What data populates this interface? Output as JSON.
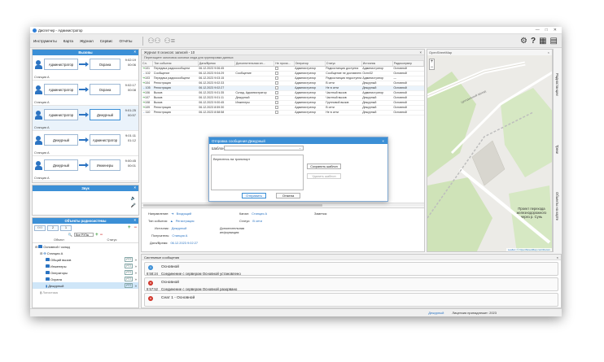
{
  "app": {
    "title": "Диспетчер - Администратор",
    "window_controls": [
      "—",
      "□",
      "✕"
    ]
  },
  "menu": {
    "items": [
      "Инструменты",
      "Карта",
      "Журнал",
      "Сервис",
      "Отчёты"
    ]
  },
  "calls": {
    "title": "Вызовы",
    "items": [
      {
        "from": "Администратор",
        "to": "Охрана",
        "time": "9:02:19",
        "dur": "00:06",
        "station": "Станция А"
      },
      {
        "from": "Администратор",
        "to": "Охрана",
        "time": "9:02:17",
        "dur": "00:08",
        "station": "Станция А"
      },
      {
        "from": "Администратор",
        "to": "Дежурный",
        "time": "9:01:25",
        "dur": "00:57",
        "station": "Станция А"
      },
      {
        "from": "Дежурный",
        "to": "Администратор",
        "time": "9:01:11",
        "dur": "01:12",
        "station": "Станция А"
      },
      {
        "from": "Дежурный",
        "to": "Инженеры",
        "time": "9:00:45",
        "dur": "00:01",
        "station": "Станция А"
      }
    ]
  },
  "sound": {
    "title": "Звук"
  },
  "objects": {
    "title": "Объекты радиосистемы",
    "tb1": "2",
    "tb2": "1",
    "tb3": "1",
    "filter": "Все РУПы",
    "col_obj": "Объект",
    "col_status": "Статус",
    "tree": [
      {
        "label": "Основной / склад",
        "indent": 0,
        "tag": ""
      },
      {
        "label": "Станция А",
        "indent": 1,
        "tag": ""
      },
      {
        "label": "Общий вызов",
        "indent": 2,
        "tag": "РТТ"
      },
      {
        "label": "Инженеры",
        "indent": 2,
        "tag": "РТТ"
      },
      {
        "label": "Операторы",
        "indent": 2,
        "tag": "РТТ"
      },
      {
        "label": "Охрана",
        "indent": 2,
        "tag": "РТТ"
      },
      {
        "label": "Дежурный",
        "indent": 2,
        "tag": "РТТ"
      },
      {
        "label": "Логистика",
        "indent": 1,
        "tag": ""
      }
    ]
  },
  "journal": {
    "title": "Журнал 8 сеансов: записей - 10",
    "group_hint": "Перетащите заголовок колонки сюда для группировки данных",
    "columns": [
      "Сл.",
      "Тип события",
      "Дата/Время",
      "Дополнительная ин...",
      "Не прочи...",
      "Оператор",
      "Статус",
      "Источник",
      "Радиосервер"
    ],
    "rows": [
      {
        "id": "101",
        "type": "Передача радиосообщени",
        "dt": "06.12.2023 9:06:45",
        "info": "",
        "op": "Администратор",
        "status": "Радиостанция доступна",
        "src": "Администратор",
        "srv": "Основной",
        "dir": "in"
      },
      {
        "id": "102",
        "type": "Сообщение",
        "dt": "06.12.2023 9:04:29",
        "info": "Сообщение",
        "op": "Администратор",
        "status": "Сообщение не доставлено",
        "src": "Ocmr32",
        "srv": "Основной",
        "dir": "out"
      },
      {
        "id": "103",
        "type": "Передача радиосообщени",
        "dt": "06.12.2023 9:03:15",
        "info": "",
        "op": "Администратор",
        "status": "Радиостанция недоступна",
        "src": "Администратор",
        "srv": "—",
        "dir": "in"
      },
      {
        "id": "104",
        "type": "Регистрация",
        "dt": "06.12.2023 9:02:33",
        "info": "",
        "op": "Администратор",
        "status": "В сети",
        "src": "Дежурный",
        "srv": "Основной",
        "dir": "in"
      },
      {
        "id": "105",
        "type": "Регистрация",
        "dt": "06.12.2023 9:02:27",
        "info": "",
        "op": "Администратор",
        "status": "Не в сети",
        "src": "Дежурный",
        "srv": "Основной",
        "dir": "out"
      },
      {
        "id": "106",
        "type": "Вызов",
        "dt": "06.12.2023 9:01:35",
        "info": "Склад, Администратор",
        "op": "Администратор",
        "status": "Частный вызов",
        "src": "Администратор",
        "srv": "Основной",
        "dir": "in"
      },
      {
        "id": "107",
        "type": "Вызов",
        "dt": "06.12.2023 9:01:11",
        "info": "Дежурный",
        "op": "Администратор",
        "status": "Частный вызов",
        "src": "Дежурный",
        "srv": "Основной",
        "dir": "in"
      },
      {
        "id": "108",
        "type": "Вызов",
        "dt": "06.12.2023 9:00:45",
        "info": "Инженеры",
        "op": "Администратор",
        "status": "Групповой вызов",
        "src": "Дежурный",
        "srv": "Основной",
        "dir": "in"
      },
      {
        "id": "109",
        "type": "Регистрация",
        "dt": "06.12.2023 8:59:30",
        "info": "",
        "op": "Администратор",
        "status": "В сети",
        "src": "Дежурный",
        "srv": "Основной",
        "dir": "in"
      },
      {
        "id": "110",
        "type": "Регистрация",
        "dt": "06.12.2023 8:58:58",
        "info": "",
        "op": "Администратор",
        "status": "Не в сети",
        "src": "Дежурный",
        "srv": "Основной",
        "dir": "out"
      }
    ]
  },
  "details": {
    "direction_k": "Направление:",
    "direction_v": "Входящий",
    "type_k": "Тип события:",
    "type_v": "Регистрация",
    "src_k": "Источник:",
    "src_v": "Дежурный",
    "rcpt_k": "Получатель:",
    "rcpt_v": "Станция А",
    "dt_k": "Дата/Время:",
    "dt_v": "06.12.2023 9:02:27",
    "chan_k": "Канал:",
    "chan_v": "Станция А",
    "stat_k": "Статус:",
    "stat_v": "В сети",
    "info_k": "Дополнительная информация:",
    "note_k": "Заметка:"
  },
  "dialog": {
    "title": "Отправка сообщения Дежурный",
    "tpl_label": "Шаблон:",
    "tpl_value": "",
    "text": "Вернитесь на транспорт",
    "save_tpl": "Сохранить шаблон",
    "del_tpl": "Удалить шаблон",
    "send": "Отправить",
    "cancel": "Отмена"
  },
  "map": {
    "title": "OpenStreetMap",
    "street": "Центральный проезд",
    "label": "Проект перехода железнодорожного через р. Сунь",
    "attribution": "Leaflet | © OpenStreetMap contributors"
  },
  "right_tabs": [
    "Радиостанции",
    "Треки",
    "Объекты на карте"
  ],
  "sys": {
    "title": "Системные сообщения",
    "messages": [
      {
        "kind": "info",
        "title": "Основной",
        "time": "8:58:24",
        "text": "Соединение с сервером Основной установлено"
      },
      {
        "kind": "err",
        "title": "Основной",
        "time": "8:57:52",
        "text": "Соединение с сервером Основной разорвано"
      },
      {
        "kind": "err",
        "title": "Сеат 1 - Основной",
        "time": "",
        "text": ""
      }
    ]
  },
  "status": {
    "user": "Дежурный",
    "license": "Лицензия принадлежит: 2023"
  },
  "colors": {
    "accent": "#3b8fd6",
    "green": "#2e9b2e",
    "red": "#d0362b"
  }
}
